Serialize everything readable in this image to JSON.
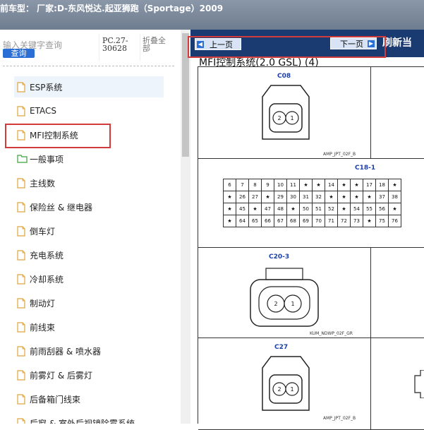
{
  "titlebar": {
    "text": "前车型：  厂家:D-东风悦达.起亚狮跑（Sportage）2009"
  },
  "search": {
    "placeholder": "输入关键字查询",
    "button": "查询",
    "pc": "PC.27-\n30628",
    "collapse": "折叠全\n部"
  },
  "tree": [
    {
      "label": "ESP系统",
      "icon": "document-icon",
      "selected": true
    },
    {
      "label": "ETACS",
      "icon": "document-icon"
    },
    {
      "label": "MFI控制系统",
      "icon": "document-icon"
    },
    {
      "label": "一般事项",
      "icon": "folder-icon"
    },
    {
      "label": "主线数",
      "icon": "document-icon"
    },
    {
      "label": "保险丝 & 继电器",
      "icon": "document-icon"
    },
    {
      "label": "倒车灯",
      "icon": "document-icon"
    },
    {
      "label": "充电系统",
      "icon": "document-icon"
    },
    {
      "label": "冷却系统",
      "icon": "document-icon"
    },
    {
      "label": "制动灯",
      "icon": "document-icon"
    },
    {
      "label": "前线束",
      "icon": "document-icon"
    },
    {
      "label": "前雨刮器 & 喷水器",
      "icon": "document-icon"
    },
    {
      "label": "前雾灯 & 后雾灯",
      "icon": "document-icon"
    },
    {
      "label": "后备箱门线束",
      "icon": "document-icon"
    },
    {
      "label": "后窗 & 室外后视镜除雾系统",
      "icon": "document-icon"
    }
  ],
  "nav": {
    "prev": "上一页",
    "next": "下一页",
    "refresh": "刷新当"
  },
  "doc": {
    "title": "MFI控制系统(2.0 GSL) (4)",
    "c08": {
      "label": "C08",
      "part": "AMP_JPT_02F_B"
    },
    "c181": {
      "label": "C18-1",
      "rows": [
        [
          "6",
          "7",
          "8",
          "9",
          "10",
          "11",
          "★",
          "★",
          "14",
          "★",
          "★",
          "17",
          "18",
          "★"
        ],
        [
          "★",
          "26",
          "27",
          "★",
          "29",
          "30",
          "31",
          "32",
          "★",
          "★",
          "★",
          "★",
          "37",
          "38"
        ],
        [
          "★",
          "45",
          "★",
          "47",
          "48",
          "★",
          "50",
          "51",
          "52",
          "★",
          "54",
          "55",
          "56",
          "★"
        ],
        [
          "★",
          "64",
          "65",
          "66",
          "67",
          "68",
          "69",
          "70",
          "71",
          "72",
          "73",
          "★",
          "75",
          "76"
        ]
      ]
    },
    "c203": {
      "label": "C20-3",
      "part": "KUM_NDWP_02F_GR"
    },
    "c27": {
      "label": "C27",
      "part": "AMP_JPT_02F_B"
    }
  }
}
